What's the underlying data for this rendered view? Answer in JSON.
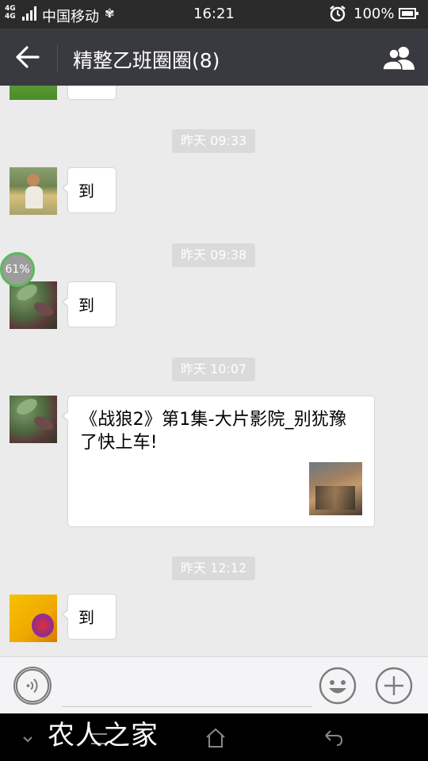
{
  "statusbar": {
    "network": "4G 4G",
    "carrier": "中国移动",
    "time": "16:21",
    "battery": "100%"
  },
  "titlebar": {
    "title": "精整乙班圈圈(8)"
  },
  "messages": [
    {
      "time": "昨天 09:33",
      "text": "到"
    },
    {
      "time": "昨天 09:38",
      "text": "到",
      "progress": "61%"
    },
    {
      "time": "昨天 10:07",
      "link_title": "《战狼2》第1集-大片影院_别犹豫了快上车!"
    },
    {
      "time": "昨天 12:12",
      "text": "到"
    }
  ],
  "navbar": {
    "watermark": "农人之家"
  },
  "colors": {
    "statusbar": "#2b2b2b",
    "titlebar": "#393a3f",
    "chat_bg": "#ebebeb",
    "time_pill": "#dadada",
    "progress_ring": "#5cb85c"
  }
}
